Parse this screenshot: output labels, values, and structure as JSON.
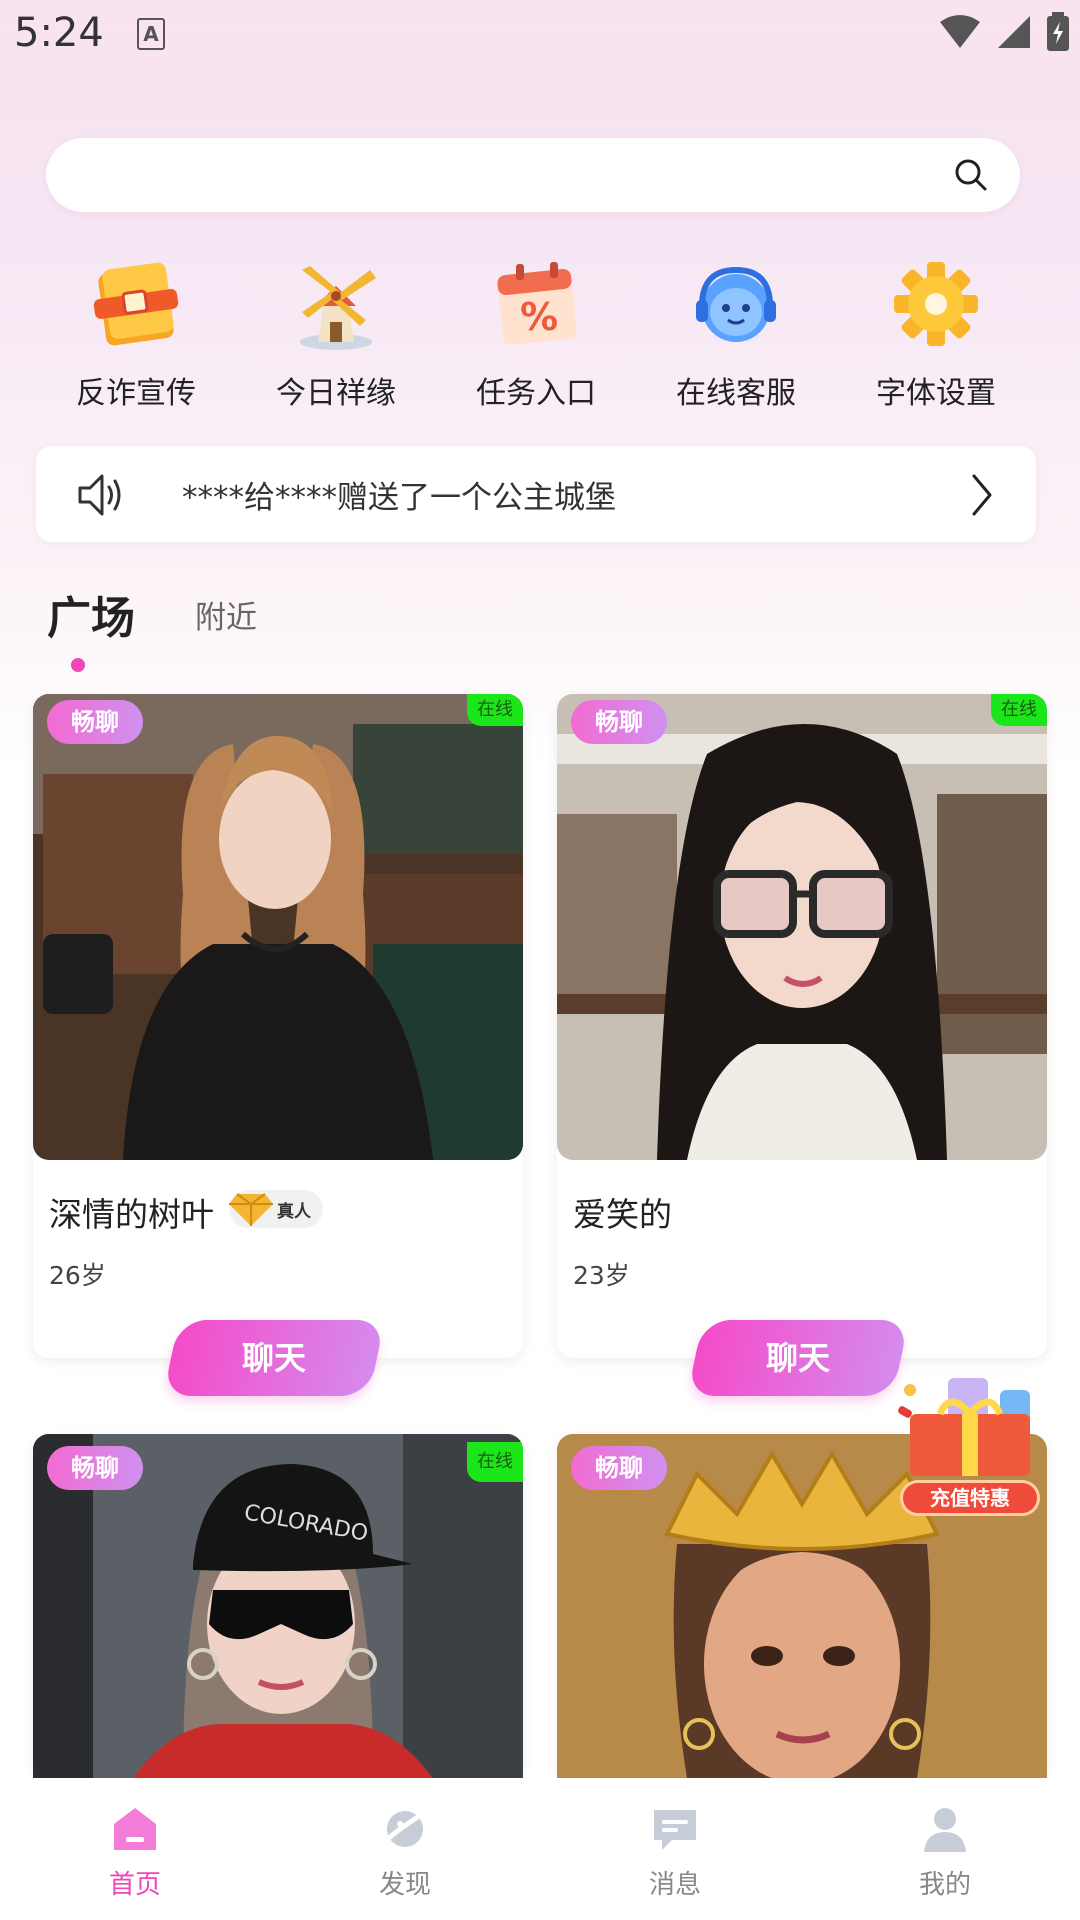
{
  "status_bar": {
    "time": "5:24",
    "notification_badge": "A"
  },
  "search": {
    "placeholder": ""
  },
  "quick_menu": [
    {
      "label": "反诈宣传",
      "icon": "book-icon"
    },
    {
      "label": "今日祥缘",
      "icon": "windmill-icon"
    },
    {
      "label": "任务入口",
      "icon": "calendar-percent-icon"
    },
    {
      "label": "在线客服",
      "icon": "headset-mascot-icon"
    },
    {
      "label": "字体设置",
      "icon": "gear-icon"
    }
  ],
  "notice": {
    "text": "****给****赠送了一个公主城堡"
  },
  "tabs": {
    "active": "广场",
    "inactive": "附近"
  },
  "cards": [
    {
      "badge": "畅聊",
      "online": "在线",
      "name": "深情的树叶",
      "real_badge": "真人",
      "age": "26岁",
      "chat": "聊天"
    },
    {
      "badge": "畅聊",
      "online": "在线",
      "name": "爱笑的",
      "age": "23岁",
      "chat": "聊天"
    },
    {
      "badge": "畅聊",
      "online": "在线"
    },
    {
      "badge": "畅聊"
    }
  ],
  "promo": {
    "label": "充值特惠"
  },
  "bottom_nav": [
    {
      "label": "首页",
      "icon": "home-icon",
      "active": true
    },
    {
      "label": "发现",
      "icon": "planet-icon"
    },
    {
      "label": "消息",
      "icon": "message-icon"
    },
    {
      "label": "我的",
      "icon": "user-icon"
    }
  ],
  "colors": {
    "accent": "#f046b9",
    "online": "#1be61a"
  }
}
